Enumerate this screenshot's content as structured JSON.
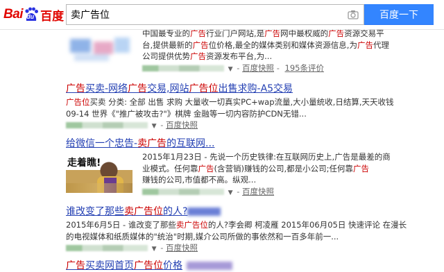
{
  "search": {
    "query": "卖广告位",
    "button_label": "百度一下"
  },
  "logo": {
    "text_latin": "Bai",
    "text_du": "du",
    "text_cn": "百度"
  },
  "results": [
    {
      "title": "",
      "snippet_lines": [
        [
          "中国最专业的",
          "广告",
          "行业门户网站,是",
          "广告",
          "网中最权威的",
          "广告",
          "资源交易平"
        ],
        [
          "台,提供最新的",
          "广告",
          "位价格,最全的媒体类别和媒体资源信息,为",
          "广告",
          "代理"
        ],
        [
          "公司提供优势",
          "广告",
          "资源发布平台,为..."
        ]
      ],
      "cache_label": "百度快照",
      "count_label": "195条评价"
    },
    {
      "title_parts": [
        "",
        "广告",
        "买卖-网络",
        "广告",
        "交易,网站",
        "广告位",
        "出售求购-A5交易"
      ],
      "snippet_lines": [
        [
          "",
          "广告位",
          "买卖 分类: 全部 出售 求购 大量收一切真实PC+wap流量,大小量统收,日结算,天天收钱"
        ],
        [
          "09-14 世界",
          "",
          "《\"推广被攻击?\"》棋牌 金融等一切内容防护CDN无错..."
        ]
      ],
      "cache_label": "百度快照"
    },
    {
      "title_parts": [
        "给微信一个忠告-",
        "卖广告",
        "的互联网..."
      ],
      "snippet_lines": [
        [
          "2015年1月23日 - 先说一个历史铁律:在互联网历史上,",
          "",
          "广告是最差的商"
        ],
        [
          "业模式。任何靠",
          "广告",
          "(含营销)赚钱的公司,都是小公司;任何靠",
          "广告"
        ],
        [
          "赚钱的公司,市值都不高。纵观...",
          "",
          ""
        ]
      ],
      "cache_label": "百度快照",
      "thumb_caption": "走着瞧!"
    },
    {
      "title_parts": [
        "谁改变了那些",
        "卖广告位",
        "的人?"
      ],
      "snippet_lines": [
        [
          "2015年6月5日 - 谁改变了那些",
          "卖广告位",
          "的人?李会卿 柯凌雁 2015年06月05日 快速评论 在漫长"
        ],
        [
          "的电视媒体和纸质媒体的\"统治\"时期,媒介公司所做的事依然和一百多年前一..."
        ]
      ],
      "cache_label": "百度快照"
    },
    {
      "title_parts": [
        "",
        "广告",
        "买卖网首页",
        "广告位",
        "价格"
      ]
    }
  ]
}
